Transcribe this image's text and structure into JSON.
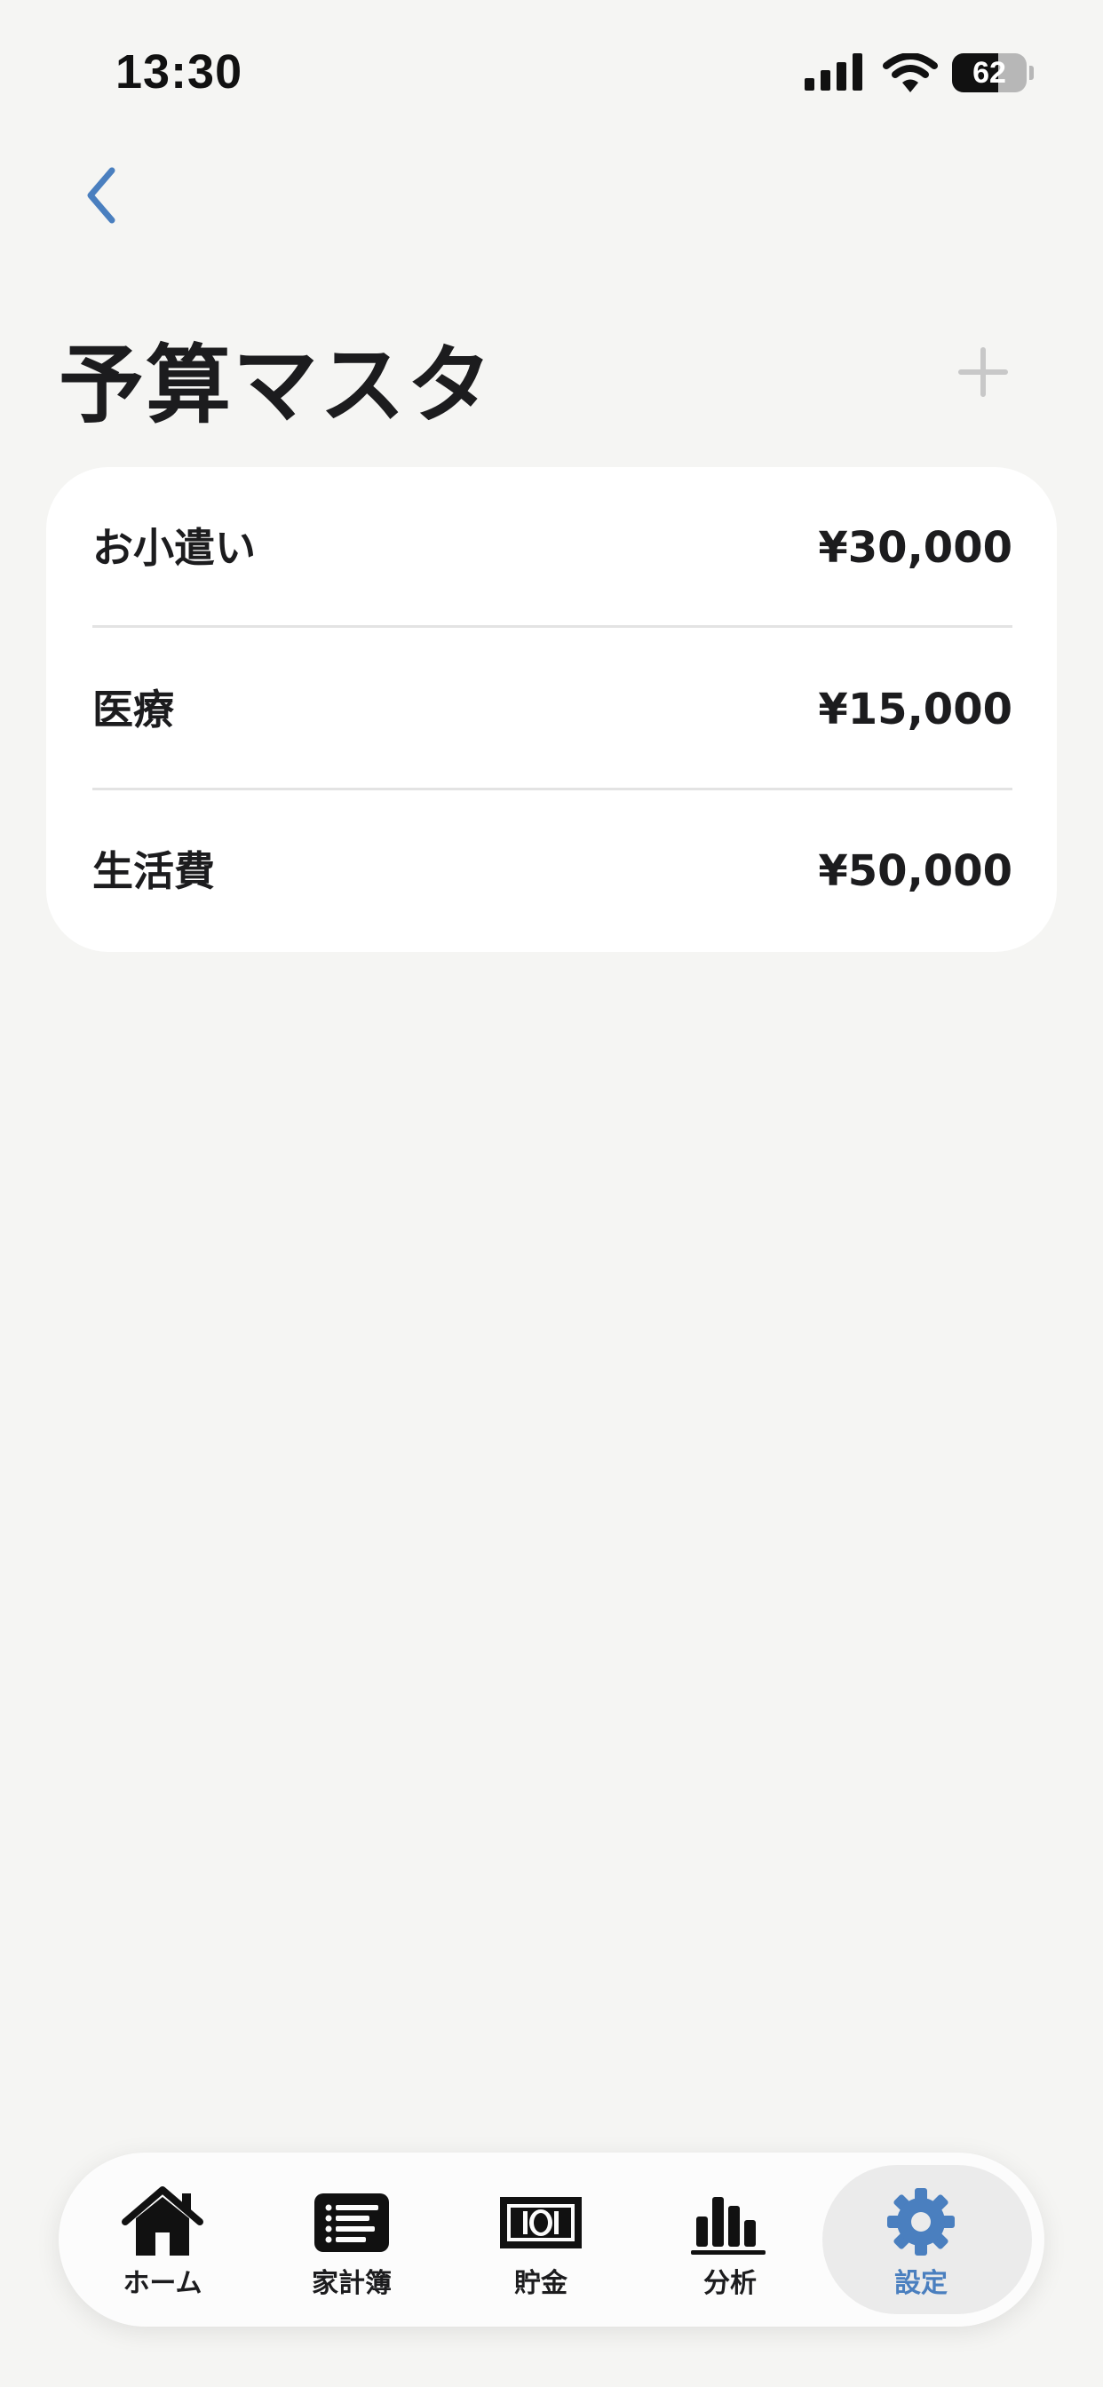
{
  "status_bar": {
    "time": "13:30",
    "battery_level": "62",
    "icons": [
      "signal-icon",
      "wifi-icon",
      "battery-icon"
    ]
  },
  "navigation": {
    "back_icon": "chevron-left-icon",
    "add_icon": "plus-icon"
  },
  "page": {
    "title": "予算マスタ"
  },
  "budgets": [
    {
      "name": "お小遣い",
      "amount": "¥30,000"
    },
    {
      "name": "医療",
      "amount": "¥15,000"
    },
    {
      "name": "生活費",
      "amount": "¥50,000"
    }
  ],
  "tab_bar": {
    "active_index": 4,
    "items": [
      {
        "label": "ホーム",
        "icon": "home-icon"
      },
      {
        "label": "家計簿",
        "icon": "list-icon"
      },
      {
        "label": "貯金",
        "icon": "money-icon"
      },
      {
        "label": "分析",
        "icon": "bar-chart-icon"
      },
      {
        "label": "設定",
        "icon": "gear-icon"
      }
    ]
  },
  "colors": {
    "accent": "#4a7fbf",
    "background": "#f5f5f3",
    "card": "#ffffff",
    "text": "#1c1c1e",
    "disabled": "#c8c8c8"
  }
}
